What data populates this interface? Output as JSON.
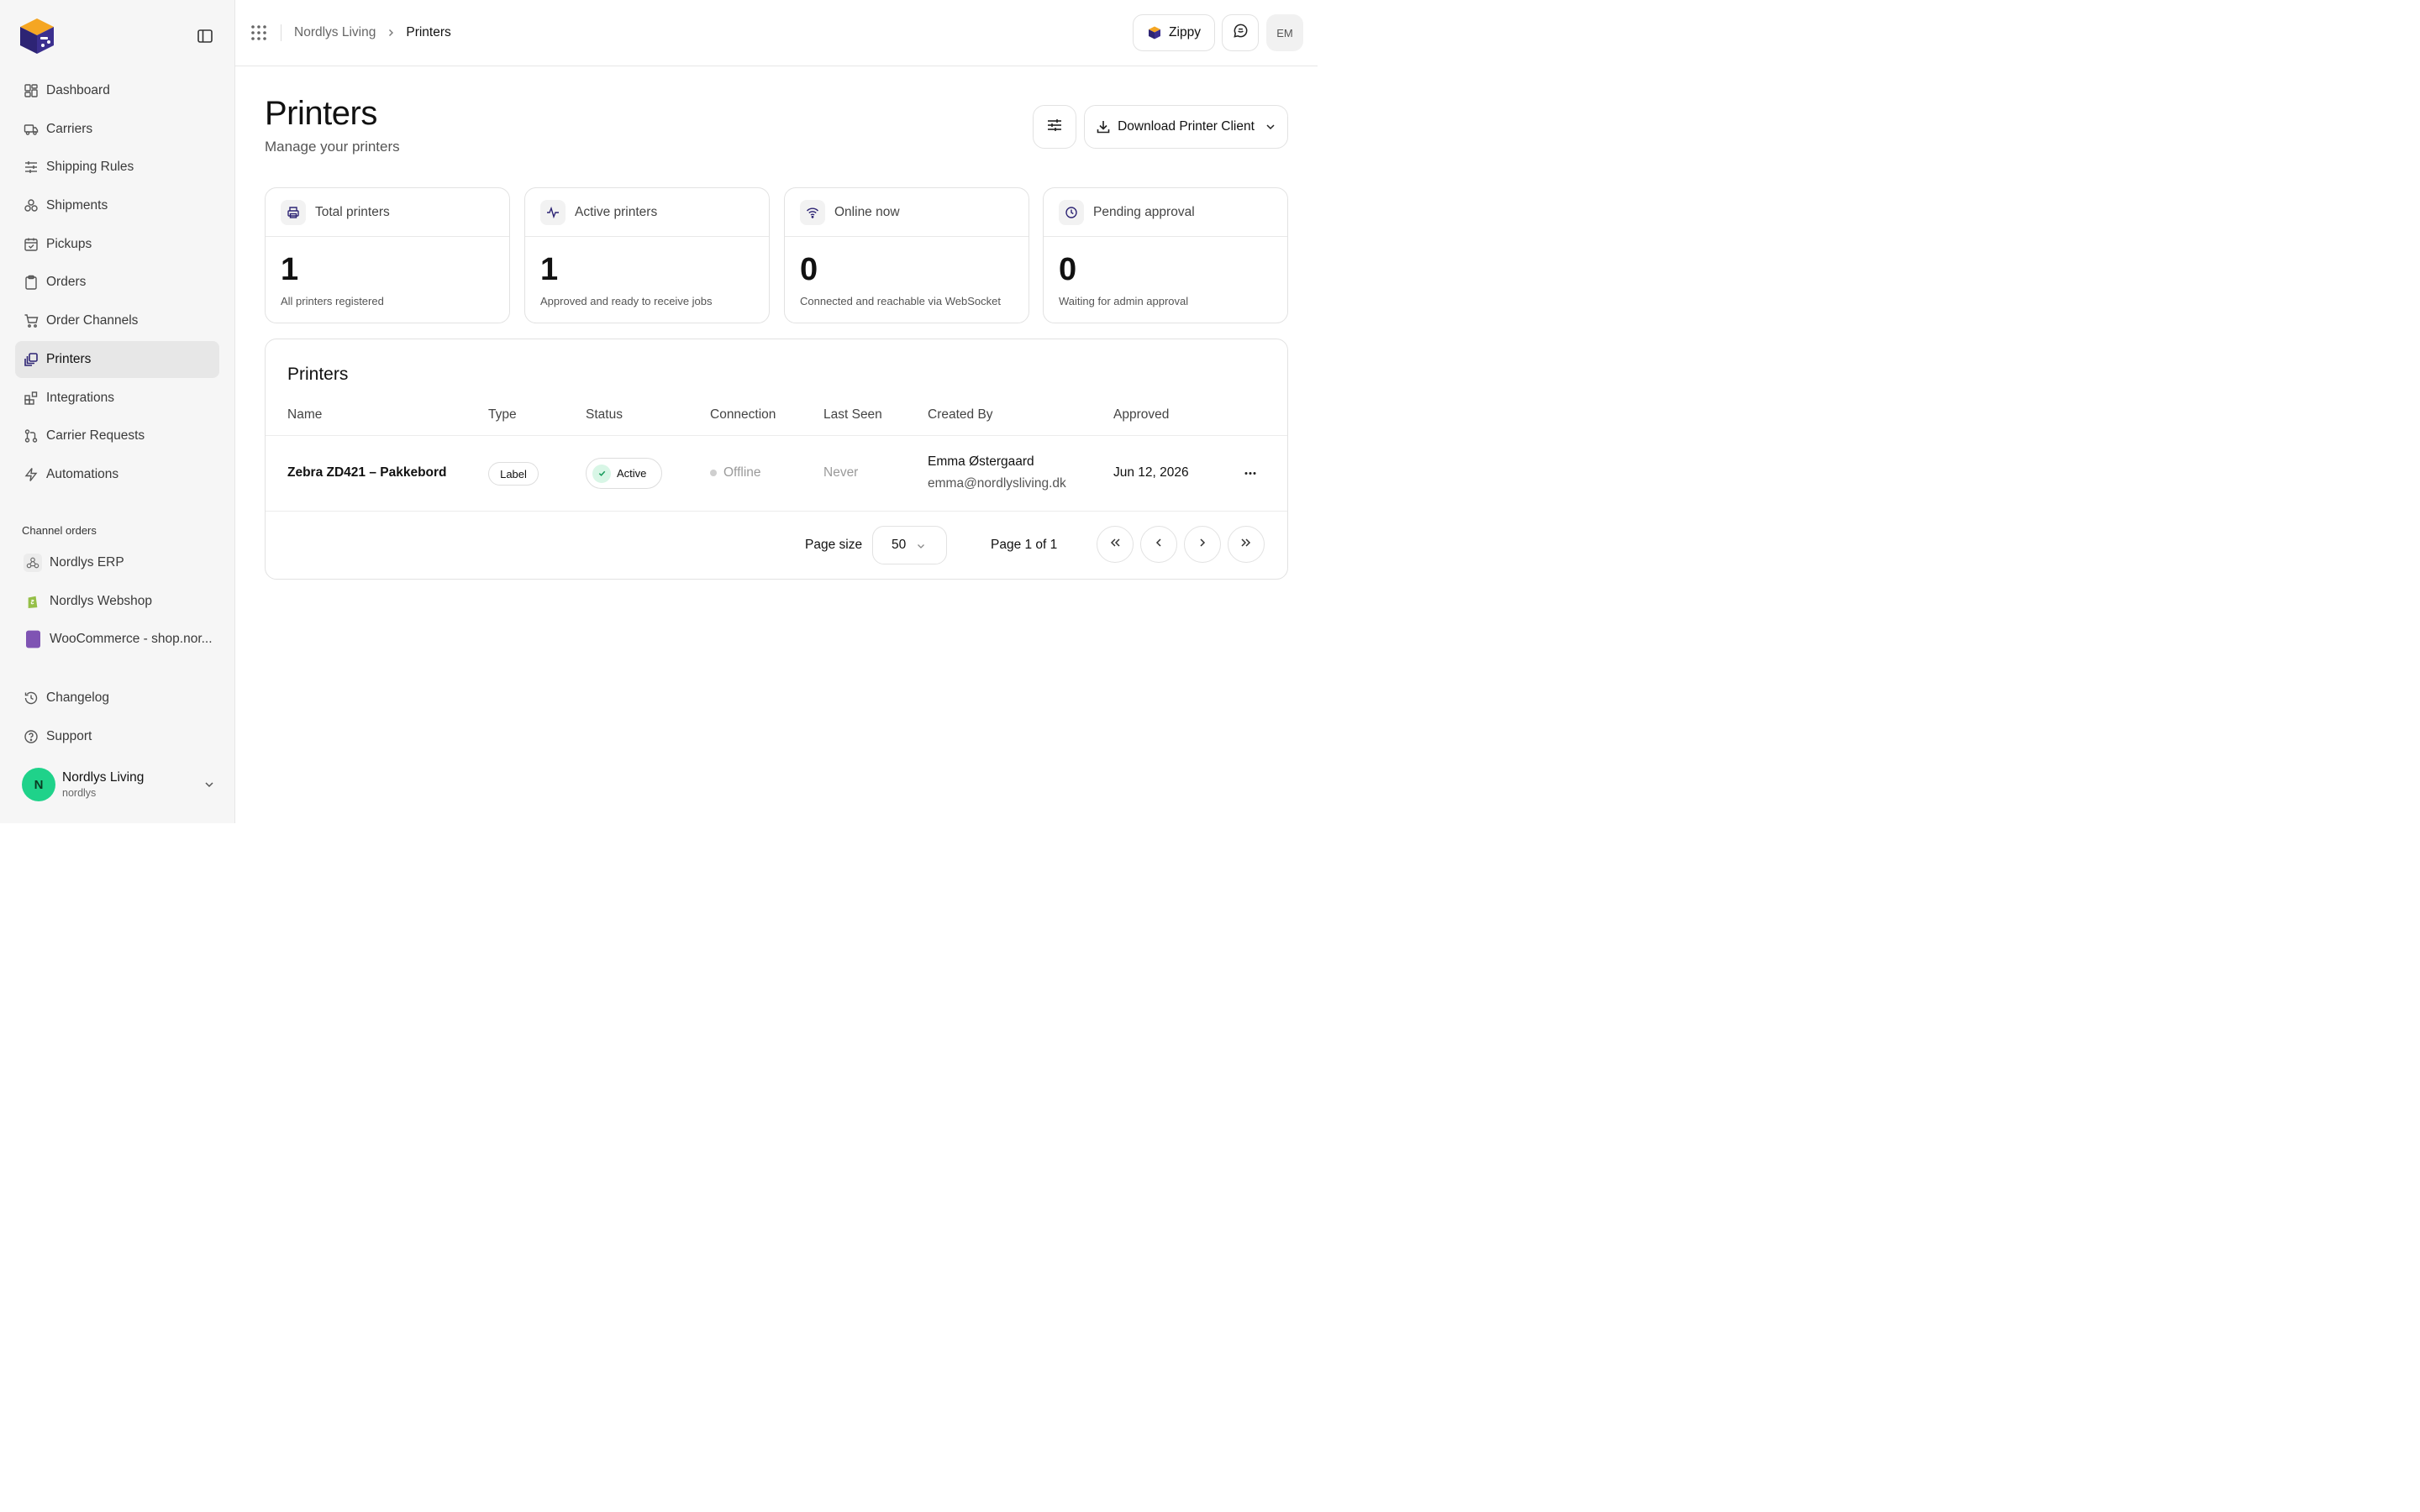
{
  "sidebar": {
    "nav": [
      {
        "label": "Dashboard",
        "icon": "dashboard-icon"
      },
      {
        "label": "Carriers",
        "icon": "truck-icon"
      },
      {
        "label": "Shipping Rules",
        "icon": "sliders-icon"
      },
      {
        "label": "Shipments",
        "icon": "boxes-icon"
      },
      {
        "label": "Pickups",
        "icon": "calendar-check-icon"
      },
      {
        "label": "Orders",
        "icon": "clipboard-icon"
      },
      {
        "label": "Order Channels",
        "icon": "cart-icon"
      },
      {
        "label": "Printers",
        "icon": "printers-icon",
        "active": true
      },
      {
        "label": "Integrations",
        "icon": "blocks-icon"
      },
      {
        "label": "Carrier Requests",
        "icon": "git-pull-icon"
      },
      {
        "label": "Automations",
        "icon": "zap-icon"
      }
    ],
    "section_label": "Channel orders",
    "channels": [
      {
        "label": "Nordlys ERP",
        "icon": "webhook-icon"
      },
      {
        "label": "Nordlys Webshop",
        "icon": "shopify-icon"
      },
      {
        "label": "WooCommerce - shop.nor...",
        "icon": "woocommerce-icon"
      }
    ],
    "bottom": [
      {
        "label": "Changelog",
        "icon": "history-icon"
      },
      {
        "label": "Support",
        "icon": "help-circle-icon"
      }
    ],
    "user": {
      "initial": "N",
      "name": "Nordlys Living",
      "sub": "nordlys"
    }
  },
  "topbar": {
    "breadcrumb_parent": "Nordlys Living",
    "breadcrumb_current": "Printers",
    "zippy_label": "Zippy",
    "avatar_initials": "EM"
  },
  "page": {
    "title": "Printers",
    "subtitle": "Manage your printers",
    "download_label": "Download Printer Client"
  },
  "stats": [
    {
      "label": "Total printers",
      "value": "1",
      "desc": "All printers registered",
      "icon": "printer-icon"
    },
    {
      "label": "Active printers",
      "value": "1",
      "desc": "Approved and ready to receive jobs",
      "icon": "activity-icon"
    },
    {
      "label": "Online now",
      "value": "0",
      "desc": "Connected and reachable via WebSocket",
      "icon": "wifi-icon"
    },
    {
      "label": "Pending approval",
      "value": "0",
      "desc": "Waiting for admin approval",
      "icon": "clock-icon"
    }
  ],
  "table": {
    "title": "Printers",
    "columns": [
      "Name",
      "Type",
      "Status",
      "Connection",
      "Last Seen",
      "Created By",
      "Approved"
    ],
    "rows": [
      {
        "name": "Zebra ZD421 – Pakkebord",
        "type": "Label",
        "status": "Active",
        "connection": "Offline",
        "last_seen": "Never",
        "created_by_name": "Emma Østergaard",
        "created_by_email": "emma@nordlysliving.dk",
        "approved": "Jun 12, 2026"
      }
    ],
    "page_size_label": "Page size",
    "page_size": "50",
    "page_info": "Page 1 of 1"
  },
  "colors": {
    "accent_green": "#1fd28a",
    "logo_orange": "#f5a623",
    "logo_navy": "#3b2f8f"
  }
}
